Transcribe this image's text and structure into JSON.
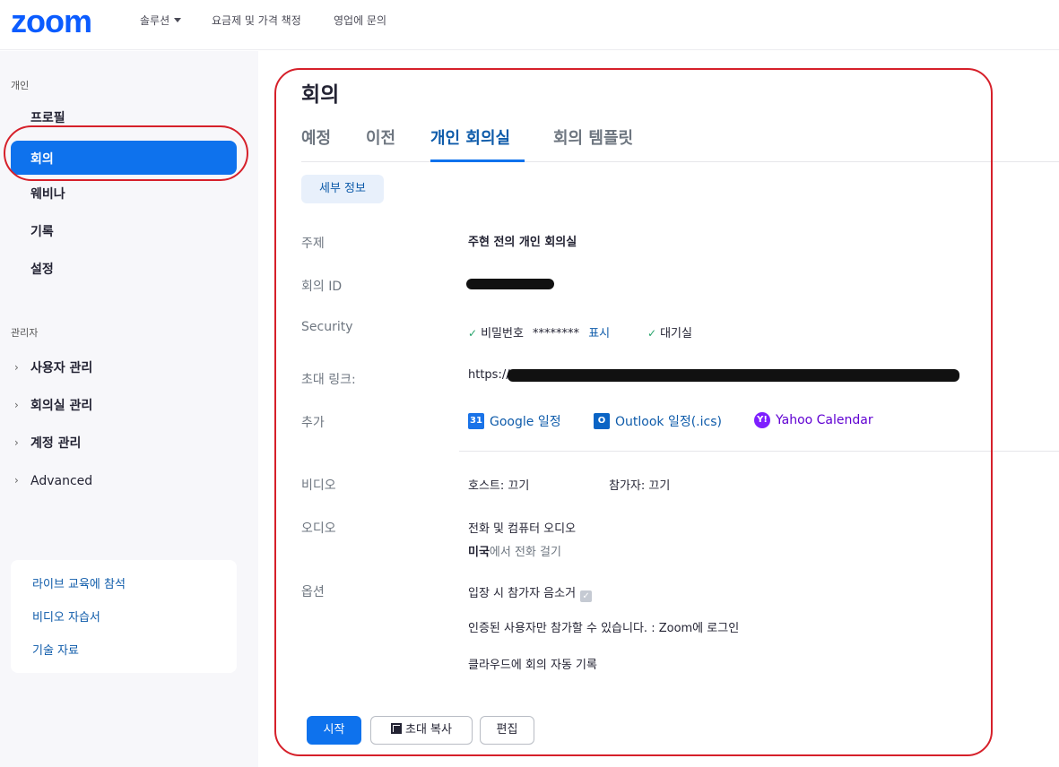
{
  "topnav": {
    "logo": "zoom",
    "solutions": "솔루션",
    "pricing": "요금제 및 가격 책정",
    "sales": "영업에 문의"
  },
  "sidebar": {
    "personal_heading": "개인",
    "items": [
      "프로필",
      "회의",
      "웨비나",
      "기록",
      "설정"
    ],
    "admin_heading": "관리자",
    "admin_items": [
      "사용자 관리",
      "회의실 관리",
      "계정 관리",
      "Advanced"
    ],
    "help_links": [
      "라이브 교육에 참석",
      "비디오 자습서",
      "기술 자료"
    ]
  },
  "main": {
    "title": "회의",
    "tabs": [
      "예정",
      "이전",
      "개인 회의실",
      "회의 템플릿"
    ],
    "detail_button": "세부 정보",
    "rows": {
      "topic_label": "주제",
      "topic_value": "주현 전의 개인 회의실",
      "id_label": "회의 ID",
      "security_label": "Security",
      "passcode_label": "비밀번호",
      "passcode_value": "********",
      "show_link": "표시",
      "waiting_room": "대기실",
      "invite_label": "초대 링크:",
      "invite_value": "https://",
      "add_label": "추가",
      "google": "Google 일정",
      "outlook": "Outlook 일정(.ics)",
      "yahoo": "Yahoo Calendar",
      "video_label": "비디오",
      "video_host": "호스트: 끄기",
      "video_participant": "참가자: 끄기",
      "audio_label": "오디오",
      "audio_value": "전화 및 컴퓨터 오디오",
      "dial_country": "미국",
      "dial_rest": "에서 전화 걸기",
      "options_label": "옵션",
      "option_1": "입장 시 참가자 음소거",
      "option_2": "인증된 사용자만 참가할 수 있습니다. : Zoom에 로그인",
      "option_3": "클라우드에 회의 자동 기록"
    },
    "buttons": {
      "start": "시작",
      "copy": "초대 복사",
      "edit": "편집"
    }
  },
  "colors": {
    "accent": "#0e72ed",
    "link": "#0e5baa",
    "annotation": "#d6202a"
  }
}
